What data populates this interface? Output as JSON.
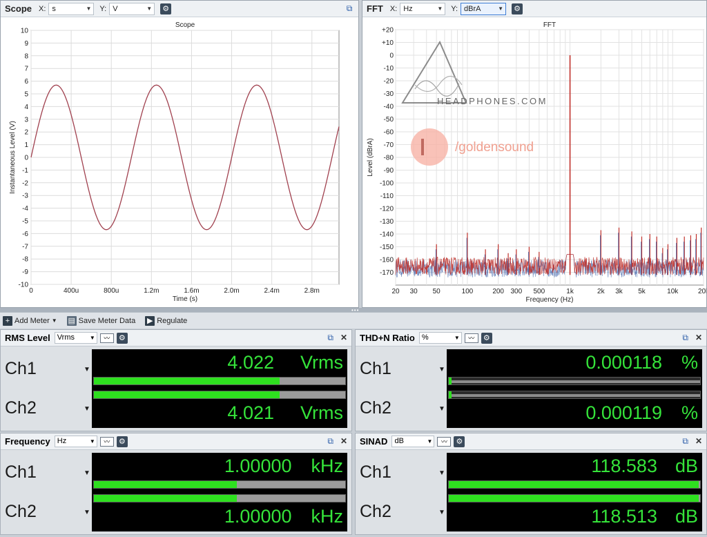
{
  "scope": {
    "title": "Scope",
    "x_label": "X:",
    "x_unit": "s",
    "y_label": "Y:",
    "y_unit": "V"
  },
  "fft": {
    "title": "FFT",
    "x_label": "X:",
    "x_unit": "Hz",
    "y_label": "Y:",
    "y_unit": "dBrA"
  },
  "watermark": {
    "brand1": "HEADPHONES.COM",
    "brand2": "/goldensound"
  },
  "chart_data": [
    {
      "type": "line",
      "title": "Scope",
      "xlabel": "Time (s)",
      "ylabel": "Instantaneous Level (V)",
      "xlim": [
        0,
        0.00307
      ],
      "ylim": [
        -10,
        10
      ],
      "x_tick_labels": [
        "0",
        "400u",
        "800u",
        "1.2m",
        "1.6m",
        "2.0m",
        "2.4m",
        "2.8m"
      ],
      "x_ticks": [
        0,
        0.0004,
        0.0008,
        0.0012,
        0.0016,
        0.002,
        0.0024,
        0.0028
      ],
      "y_ticks": [
        10,
        9,
        8,
        7,
        6,
        5,
        4,
        3,
        2,
        1,
        0,
        -1,
        -2,
        -3,
        -4,
        -5,
        -6,
        -7,
        -8,
        -9,
        -10
      ],
      "grid": true,
      "series": [
        {
          "color": "#a0404e",
          "waveform": "sine",
          "amplitude": 5.69,
          "frequency": 1000,
          "phase_deg": 0
        }
      ]
    },
    {
      "type": "line",
      "title": "FFT",
      "xlabel": "Frequency (Hz)",
      "ylabel": "Level (dBrA)",
      "x_scale": "log",
      "xlim": [
        20,
        20000
      ],
      "ylim": [
        -180,
        20
      ],
      "x_tick_labels": [
        "20",
        "30",
        "50",
        "100",
        "200",
        "300",
        "500",
        "1k",
        "2k",
        "3k",
        "5k",
        "10k",
        "20k"
      ],
      "x_ticks": [
        20,
        30,
        50,
        100,
        200,
        300,
        500,
        1000,
        2000,
        3000,
        5000,
        10000,
        20000
      ],
      "y_tick_labels": [
        "+20",
        "+10",
        "0",
        "-10",
        "-20",
        "-30",
        "-40",
        "-50",
        "-60",
        "-70",
        "-80",
        "-90",
        "-100",
        "-110",
        "-120",
        "-130",
        "-140",
        "-150",
        "-160",
        "-170"
      ],
      "y_ticks": [
        20,
        10,
        0,
        -10,
        -20,
        -30,
        -40,
        -50,
        -60,
        -70,
        -80,
        -90,
        -100,
        -110,
        -120,
        -130,
        -140,
        -150,
        -160,
        -170
      ],
      "grid": true,
      "noise_floor_db": -165,
      "fundamental": {
        "freq": 1000,
        "level": 0
      },
      "spurs": [
        {
          "freq": 50,
          "level": -148
        },
        {
          "freq": 100,
          "level": -139
        },
        {
          "freq": 150,
          "level": -152
        },
        {
          "freq": 200,
          "level": -148
        },
        {
          "freq": 250,
          "level": -155
        },
        {
          "freq": 300,
          "level": -152
        },
        {
          "freq": 400,
          "level": -150
        },
        {
          "freq": 500,
          "level": -154
        },
        {
          "freq": 2000,
          "level": -137
        },
        {
          "freq": 3000,
          "level": -135
        },
        {
          "freq": 4000,
          "level": -138
        },
        {
          "freq": 5000,
          "level": -142
        },
        {
          "freq": 6000,
          "level": -140
        },
        {
          "freq": 7000,
          "level": -142
        },
        {
          "freq": 8000,
          "level": -151
        },
        {
          "freq": 9000,
          "level": -148
        },
        {
          "freq": 11000,
          "level": -143
        },
        {
          "freq": 13000,
          "level": -142
        },
        {
          "freq": 15000,
          "level": -141
        },
        {
          "freq": 17000,
          "level": -140
        },
        {
          "freq": 19000,
          "level": -135
        }
      ],
      "series": [
        {
          "color": "#3a5fa8"
        },
        {
          "color": "#c0302a"
        }
      ]
    }
  ],
  "toolbar": {
    "add_meter": "Add Meter",
    "save_meter": "Save Meter Data",
    "regulate": "Regulate"
  },
  "meters": {
    "rms": {
      "title": "RMS Level",
      "unit": "Vrms",
      "ch1": {
        "label": "Ch1",
        "value": "4.022",
        "unit": "Vrms",
        "bar": 0.74
      },
      "ch2": {
        "label": "Ch2",
        "value": "4.021",
        "unit": "Vrms",
        "bar": 0.74
      }
    },
    "thdn": {
      "title": "THD+N Ratio",
      "unit": "%",
      "ch1": {
        "label": "Ch1",
        "value": "0.000118",
        "unit": "%",
        "bar": 0.01
      },
      "ch2": {
        "label": "Ch2",
        "value": "0.000119",
        "unit": "%",
        "bar": 0.01
      }
    },
    "freq": {
      "title": "Frequency",
      "unit": "Hz",
      "ch1": {
        "label": "Ch1",
        "value": "1.00000",
        "unit": "kHz",
        "bar": 0.57
      },
      "ch2": {
        "label": "Ch2",
        "value": "1.00000",
        "unit": "kHz",
        "bar": 0.57
      }
    },
    "sinad": {
      "title": "SINAD",
      "unit": "dB",
      "ch1": {
        "label": "Ch1",
        "value": "118.583",
        "unit": "dB",
        "bar": 0.995
      },
      "ch2": {
        "label": "Ch2",
        "value": "118.513",
        "unit": "dB",
        "bar": 0.995
      }
    }
  }
}
